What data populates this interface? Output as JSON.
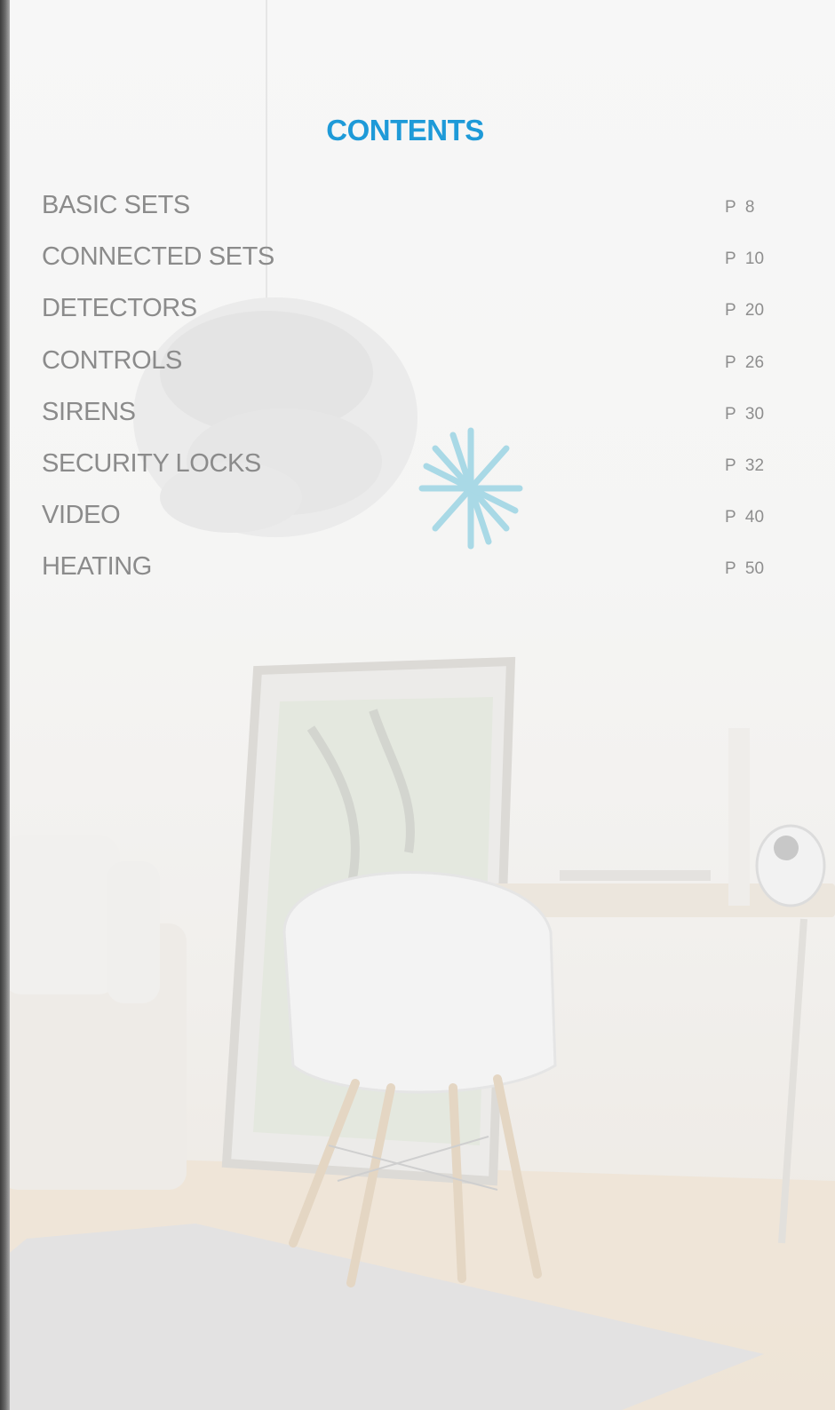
{
  "contents": {
    "title": "CONTENTS",
    "items": [
      {
        "label": "BASIC SETS",
        "page": "P  8"
      },
      {
        "label": "CONNECTED SETS",
        "page": "P  10"
      },
      {
        "label": "DETECTORS",
        "page": "P  20"
      },
      {
        "label": "CONTROLS",
        "page": "P  26"
      },
      {
        "label": "SIRENS",
        "page": "P  30"
      },
      {
        "label": "SECURITY LOCKS",
        "page": "P  32"
      },
      {
        "label": "VIDEO",
        "page": "P  40"
      },
      {
        "label": "HEATING",
        "page": "P  50"
      }
    ]
  },
  "colors": {
    "title": "#1e9ad8",
    "text": "#8b8b8b",
    "background": "#f7f7f7"
  },
  "background_image": {
    "icons": [
      "pendant-lamp-icon",
      "wall-clock-icon",
      "mirror-icon",
      "chair-icon",
      "armchair-icon",
      "desk-icon",
      "camera-icon",
      "rug-icon"
    ]
  }
}
